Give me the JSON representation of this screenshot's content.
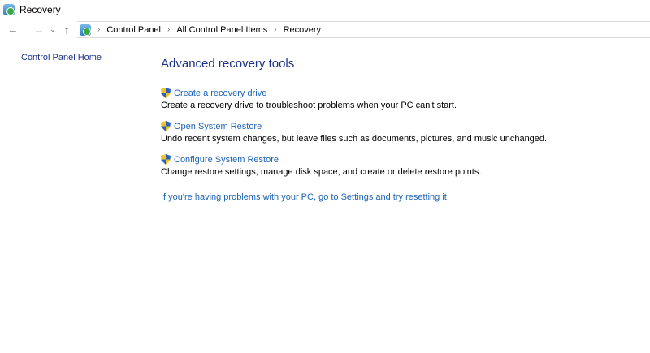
{
  "window": {
    "title": "Recovery"
  },
  "breadcrumb": [
    "Control Panel",
    "All Control Panel Items",
    "Recovery"
  ],
  "sidebar": {
    "home": "Control Panel Home"
  },
  "main": {
    "heading": "Advanced recovery tools",
    "items": [
      {
        "link": "Create a recovery drive",
        "desc": "Create a recovery drive to troubleshoot problems when your PC can't start."
      },
      {
        "link": "Open System Restore",
        "desc": "Undo recent system changes, but leave files such as documents, pictures, and music unchanged."
      },
      {
        "link": "Configure System Restore",
        "desc": "Change restore settings, manage disk space, and create or delete restore points."
      }
    ],
    "reset_link": "If you're having problems with your PC, go to Settings and try resetting it"
  }
}
